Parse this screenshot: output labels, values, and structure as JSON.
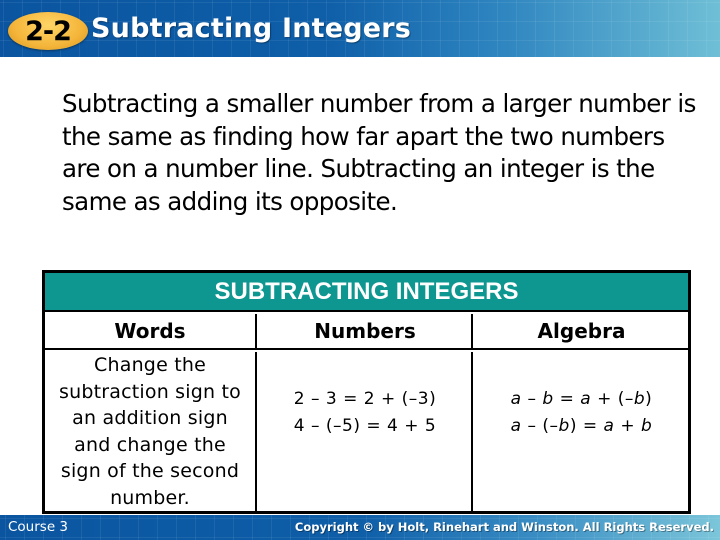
{
  "header": {
    "lesson_number": "2-2",
    "title": "Subtracting Integers"
  },
  "intro_text": "Subtracting a smaller number from a larger number is the same as finding how far apart the two numbers are on a number line. Subtracting an integer is the same as adding its opposite.",
  "table": {
    "title": "SUBTRACTING INTEGERS",
    "columns": [
      "Words",
      "Numbers",
      "Algebra"
    ],
    "words": "Change the subtraction sign to an addition sign and change the sign of the second number.",
    "numbers": [
      "2 – 3 = 2 + (–3)",
      "4 – (–5) = 4 + 5"
    ],
    "algebra": [
      [
        {
          "t": "a",
          "v": true
        },
        {
          "t": " – ",
          "v": false
        },
        {
          "t": "b",
          "v": true
        },
        {
          "t": " = ",
          "v": false
        },
        {
          "t": "a",
          "v": true
        },
        {
          "t": " + (–",
          "v": false
        },
        {
          "t": "b",
          "v": true
        },
        {
          "t": ")",
          "v": false
        }
      ],
      [
        {
          "t": "a",
          "v": true
        },
        {
          "t": " – (–",
          "v": false
        },
        {
          "t": "b",
          "v": true
        },
        {
          "t": ") = ",
          "v": false
        },
        {
          "t": "a",
          "v": true
        },
        {
          "t": " + ",
          "v": false
        },
        {
          "t": "b",
          "v": true
        }
      ]
    ]
  },
  "footer": {
    "course": "Course 3",
    "copyright": "Copyright © by Holt, Rinehart and Winston. All Rights Reserved."
  },
  "colors": {
    "header_blue": "#0b55a0",
    "header_teal_end": "#6fbfd6",
    "badge_yellow": "#f4b53a",
    "table_title_teal": "#0e9690"
  }
}
